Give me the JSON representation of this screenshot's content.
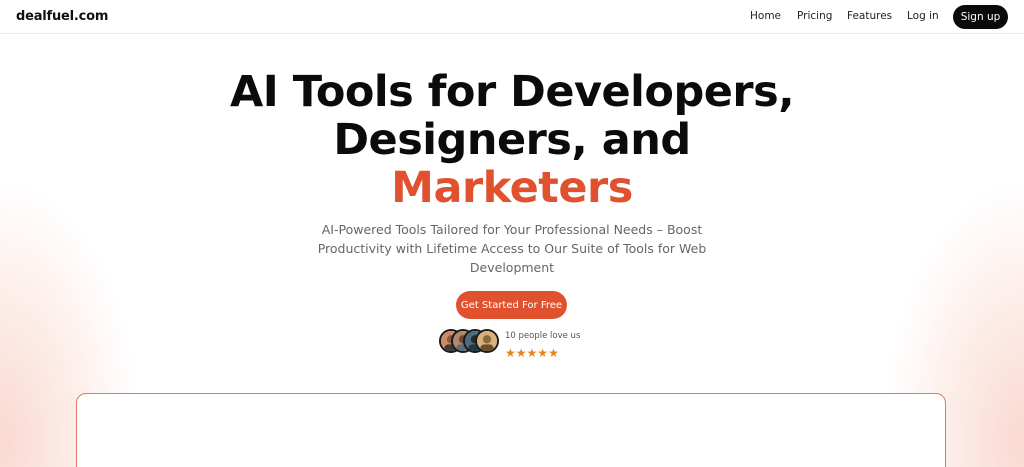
{
  "nav": {
    "logo": "dealfuel.com",
    "links": [
      "Home",
      "Pricing",
      "Features",
      "Log in"
    ],
    "signup": "Sign up"
  },
  "hero": {
    "title_line1": "AI Tools for Developers,",
    "title_line2": "Designers, and",
    "title_accent": "Marketers",
    "subtitle": "AI-Powered Tools Tailored for Your Professional Needs – Boost Productivity with Lifetime Access to Our Suite of Tools for Web Development",
    "cta": "Get Started For Free"
  },
  "social_proof": {
    "text": "10 people love us",
    "rating": 5,
    "star_glyph": "★"
  },
  "colors": {
    "accent": "#e0522f",
    "star": "#e8841a",
    "dark": "#0a0a0a"
  }
}
